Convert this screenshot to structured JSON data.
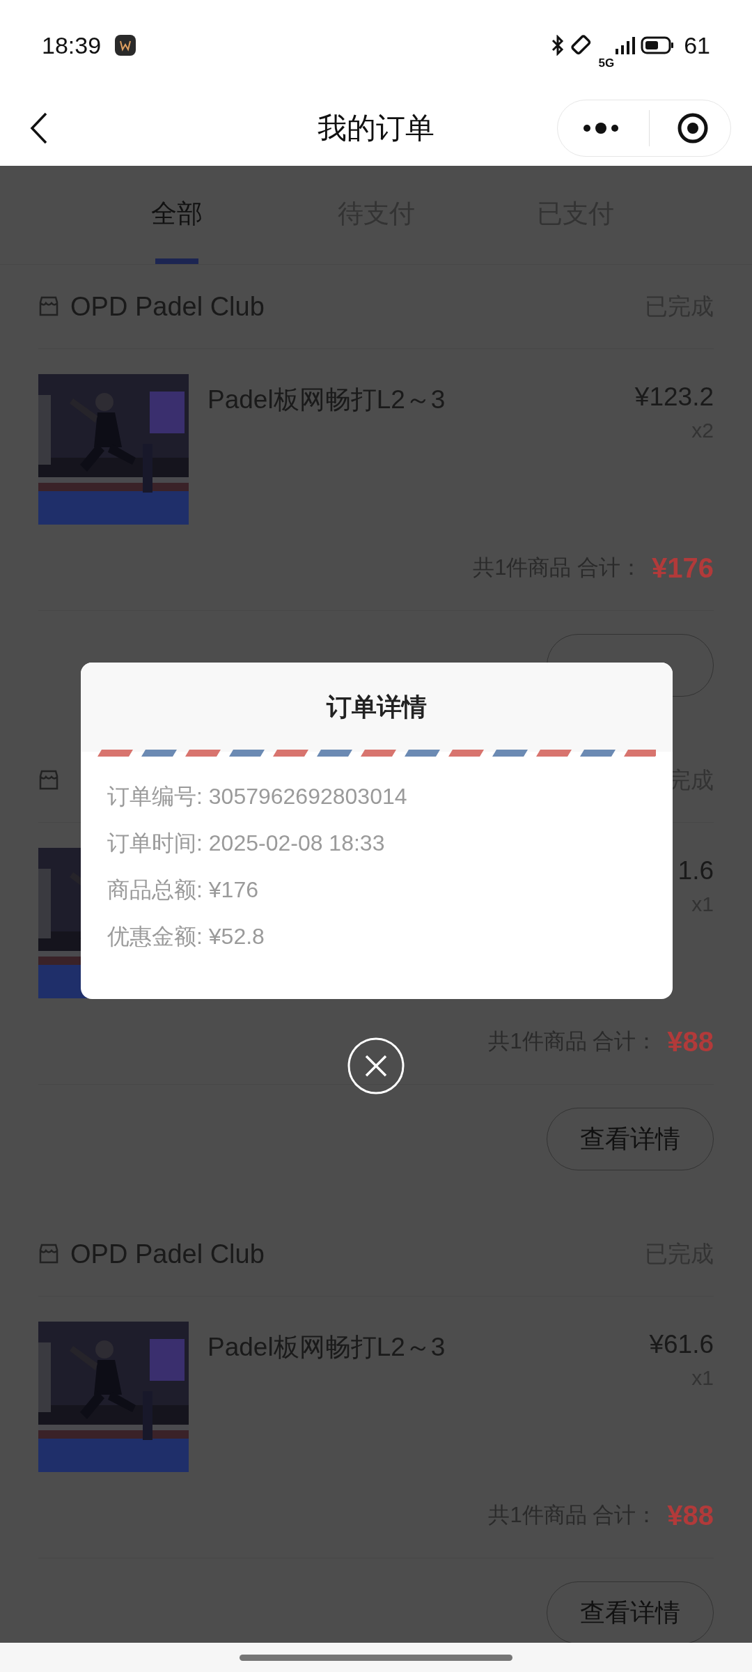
{
  "status_bar": {
    "time": "18:39",
    "network": "5G",
    "battery": "61"
  },
  "nav": {
    "title": "我的订单"
  },
  "tabs": [
    {
      "label": "全部",
      "selected": true
    },
    {
      "label": "待支付",
      "selected": false
    },
    {
      "label": "已支付",
      "selected": false
    }
  ],
  "orders": [
    {
      "shop": "OPD Padel Club",
      "status": "已完成",
      "product": "Padel板网畅打L2～3",
      "price": "¥123.2",
      "quantity": "x2",
      "summary": "共1件商品 合计：",
      "total": "¥176"
    },
    {
      "status": "完成",
      "price": "1.6",
      "quantity": "x1",
      "summary": "共1件商品 合计：",
      "total": "¥88",
      "button": "查看详情"
    },
    {
      "shop": "OPD Padel Club",
      "status": "已完成",
      "product": "Padel板网畅打L2～3",
      "price": "¥61.6",
      "quantity": "x1",
      "summary": "共1件商品 合计：",
      "total": "¥88",
      "button": "查看详情"
    }
  ],
  "modal": {
    "title": "订单详情",
    "rows": [
      "订单编号: 3057962692803014",
      "订单时间: 2025-02-08 18:33",
      "商品总额: ¥176",
      "优惠金额: ¥52.8"
    ]
  }
}
